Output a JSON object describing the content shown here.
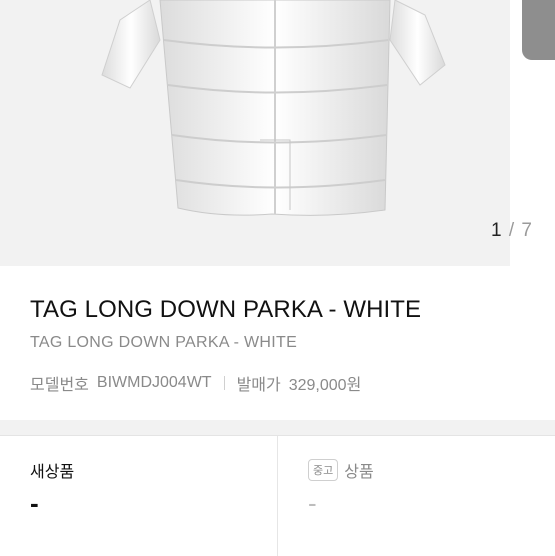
{
  "gallery": {
    "current": "1",
    "separator": "/",
    "total": "7",
    "image_subject": "white-long-down-parka"
  },
  "product": {
    "title": "TAG LONG DOWN PARKA - WHITE",
    "subtitle": "TAG LONG DOWN PARKA - WHITE",
    "model_label": "모델번호",
    "model_value": "BIWMDJ004WT",
    "release_price_label": "발매가",
    "release_price_value": "329,000원"
  },
  "trade": {
    "new_label": "새상품",
    "new_value": "-",
    "used_badge": "중고",
    "used_label": "상품",
    "used_value": "-"
  },
  "colors": {
    "background": "#f2f2f2",
    "card": "#ffffff",
    "text_primary": "#111111",
    "text_secondary": "#8a8a8a"
  }
}
